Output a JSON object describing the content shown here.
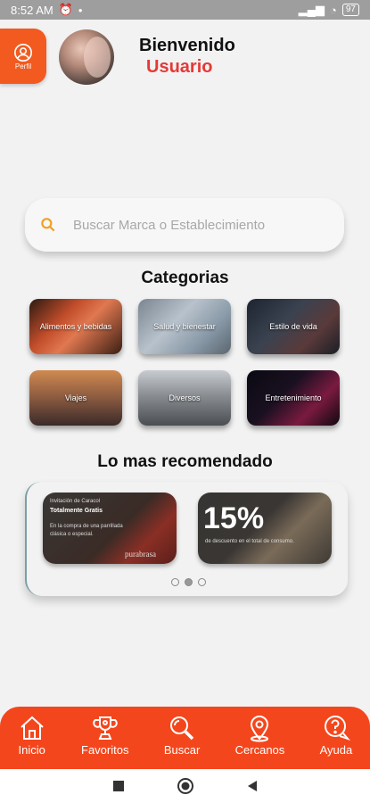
{
  "status_bar": {
    "time": "8:52 AM",
    "battery": "97"
  },
  "profile": {
    "label": "Perfil"
  },
  "header": {
    "welcome": "Bienvenido",
    "user": "Usuario"
  },
  "search": {
    "placeholder": "Buscar Marca o Establecimiento"
  },
  "categories": {
    "title": "Categorias",
    "items": [
      {
        "label": "Alimentos y bebidas"
      },
      {
        "label": "Salud y bienestar"
      },
      {
        "label": "Estilo de vida"
      },
      {
        "label": "Viajes"
      },
      {
        "label": "Diversos"
      },
      {
        "label": "Entretenimiento"
      }
    ]
  },
  "recommended": {
    "title": "Lo mas recomendado",
    "promo1": {
      "line1": "Invitación de Caracol",
      "headline": "Totalmente Gratis",
      "line2": "En la compra de una parrillada",
      "line3": "clásica o especial.",
      "brand": "purabrasa"
    },
    "promo2": {
      "percent": "15%",
      "caption": "de descuento en el total de consumo."
    }
  },
  "bottom_nav": {
    "items": [
      {
        "label": "Inicio"
      },
      {
        "label": "Favoritos"
      },
      {
        "label": "Buscar"
      },
      {
        "label": "Cercanos"
      },
      {
        "label": "Ayuda"
      }
    ]
  },
  "colors": {
    "accent": "#f4461c",
    "user_text": "#e53935"
  }
}
